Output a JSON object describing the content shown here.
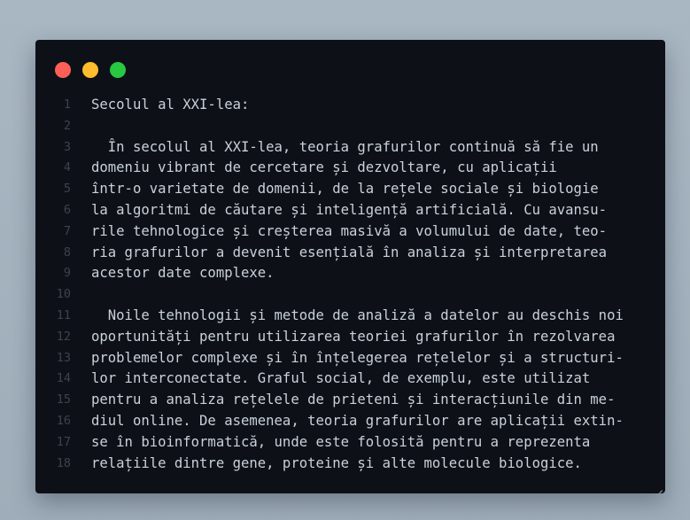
{
  "window": {
    "controls": [
      "close",
      "minimize",
      "maximize"
    ],
    "colors": {
      "close": "#ff5f57",
      "minimize": "#febc2e",
      "maximize": "#28c840"
    }
  },
  "editor": {
    "lines": [
      {
        "num": "1",
        "text": "Secolul al XXI-lea:"
      },
      {
        "num": "2",
        "text": ""
      },
      {
        "num": "3",
        "text": "  În secolul al XXI-lea, teoria grafurilor continuă să fie un"
      },
      {
        "num": "4",
        "text": "domeniu vibrant de cercetare și dezvoltare, cu aplicații"
      },
      {
        "num": "5",
        "text": "într-o varietate de domenii, de la rețele sociale și biologie"
      },
      {
        "num": "6",
        "text": "la algoritmi de căutare și inteligență artificială. Cu avansu-"
      },
      {
        "num": "7",
        "text": "rile tehnologice și creșterea masivă a volumului de date, teo-"
      },
      {
        "num": "8",
        "text": "ria grafurilor a devenit esențială în analiza și interpretarea"
      },
      {
        "num": "9",
        "text": "acestor date complexe."
      },
      {
        "num": "10",
        "text": ""
      },
      {
        "num": "11",
        "text": "  Noile tehnologii și metode de analiză a datelor au deschis noi"
      },
      {
        "num": "12",
        "text": "oportunități pentru utilizarea teoriei grafurilor în rezolvarea"
      },
      {
        "num": "13",
        "text": "problemelor complexe și în înțelegerea rețelelor și a structuri-"
      },
      {
        "num": "14",
        "text": "lor interconectate. Graful social, de exemplu, este utilizat"
      },
      {
        "num": "15",
        "text": "pentru a analiza rețelele de prieteni și interacțiunile din me-"
      },
      {
        "num": "16",
        "text": "diul online. De asemenea, teoria grafurilor are aplicații extin-"
      },
      {
        "num": "17",
        "text": "se în bioinformatică, unde este folosită pentru a reprezenta"
      },
      {
        "num": "18",
        "text": "relațiile dintre gene, proteine și alte molecule biologice."
      }
    ]
  }
}
